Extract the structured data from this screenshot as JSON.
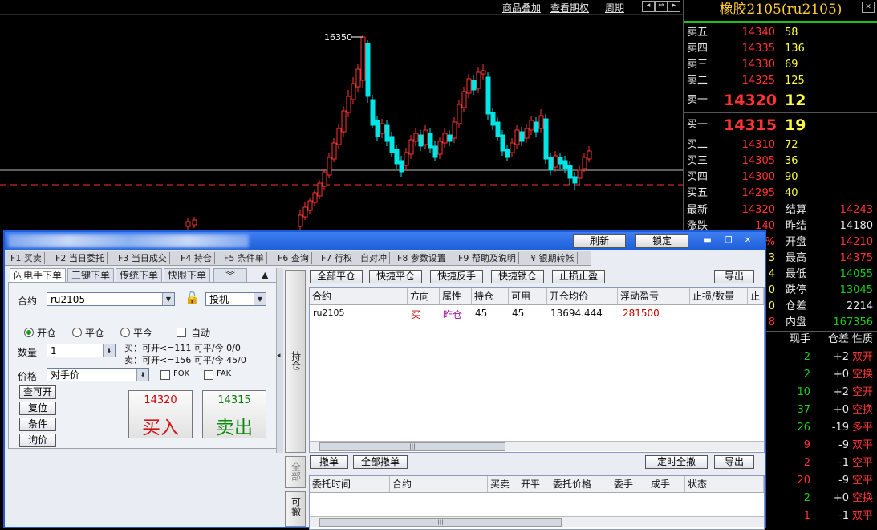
{
  "top_menu": {
    "items": [
      "商品叠加",
      "查看期权",
      "周期"
    ]
  },
  "chart": {
    "high_label": "16350",
    "colors": {
      "up": "#ff3232",
      "down": "#00e5e5",
      "ref_line": "#ff3030"
    }
  },
  "quote": {
    "title": "橡胶2105(ru2105)",
    "asks": [
      {
        "label": "卖五",
        "price": "14340",
        "vol": "58"
      },
      {
        "label": "卖四",
        "price": "14335",
        "vol": "136"
      },
      {
        "label": "卖三",
        "price": "14330",
        "vol": "69"
      },
      {
        "label": "卖二",
        "price": "14325",
        "vol": "125"
      },
      {
        "label": "卖一",
        "price": "14320",
        "vol": "12"
      }
    ],
    "bids": [
      {
        "label": "买一",
        "price": "14315",
        "vol": "19"
      },
      {
        "label": "买二",
        "price": "14310",
        "vol": "72"
      },
      {
        "label": "买三",
        "price": "14305",
        "vol": "36"
      },
      {
        "label": "买四",
        "price": "14300",
        "vol": "90"
      },
      {
        "label": "买五",
        "price": "14295",
        "vol": "40"
      }
    ],
    "stats": [
      {
        "l1": "最新",
        "v1": "14320",
        "l2": "结算",
        "v2": "14243"
      },
      {
        "l1": "涨跌",
        "v1": "140",
        "l2": "昨结",
        "v2": "14180"
      },
      {
        "l1": "",
        "v1": "%",
        "l2": "开盘",
        "v2": "14210"
      },
      {
        "l1": "",
        "v1": "3",
        "l2": "最高",
        "v2": "14375"
      },
      {
        "l1": "",
        "v1": "4",
        "l2": "最低",
        "v2": "14055"
      },
      {
        "l1": "",
        "v1": "0",
        "l2": "跌停",
        "v2": "13045"
      },
      {
        "l1": "",
        "v1": "0",
        "l2": "仓差",
        "v2": "2214"
      },
      {
        "l1": "",
        "v1": "8",
        "l2": "内盘",
        "v2": "167356"
      }
    ],
    "tick_header": {
      "h1": "现手",
      "h2": "仓差",
      "h3": "性质"
    },
    "ticks": [
      {
        "a": "2",
        "b": "+2",
        "c": "双开"
      },
      {
        "a": "2",
        "b": "+0",
        "c": "空换"
      },
      {
        "a": "10",
        "b": "+2",
        "c": "空开"
      },
      {
        "a": "37",
        "b": "+0",
        "c": "空换"
      },
      {
        "a": "26",
        "b": "-19",
        "c": "多平"
      },
      {
        "a": "9",
        "b": "-9",
        "c": "双平"
      },
      {
        "a": "2",
        "b": "-1",
        "c": "空平"
      },
      {
        "a": "20",
        "b": "-9",
        "c": "空平"
      },
      {
        "a": "2",
        "b": "+0",
        "c": "空换"
      },
      {
        "a": "1",
        "b": "-1",
        "c": "双平"
      }
    ]
  },
  "window": {
    "title_buttons": {
      "refresh": "刷新",
      "lock": "锁定"
    },
    "fkeys": [
      "F1 买卖",
      "F2 当日委托",
      "F3 当日成交",
      "F4 持仓",
      "F5 条件单",
      "F6 查询",
      "F7 行权",
      "自对冲",
      "F8 参数设置",
      "F9 帮助及说明",
      "¥ 银期转帐"
    ],
    "order": {
      "tabs": [
        "闪电手下单",
        "三键下单",
        "传统下单",
        "快限下单"
      ],
      "contract_label": "合约",
      "contract_value": "ru2105",
      "hedge_value": "投机",
      "radios": [
        "开仓",
        "平仓",
        "平今"
      ],
      "auto_label": "自动",
      "qty_label": "数量",
      "qty_value": "1",
      "buy_info": "买：可开<=111  可平/今 0/0",
      "sell_info": "卖：可开<=156  可平/今 45/0",
      "price_label": "价格",
      "price_value": "对手价",
      "fok": "FOK",
      "fak": "FAK",
      "side_buttons": [
        "查可开",
        "复位",
        "条件",
        "询价"
      ],
      "buy_price": "14320",
      "buy_label": "买入",
      "sell_price": "14315",
      "sell_label": "卖出"
    },
    "side_tabs": {
      "position": "持仓",
      "all": "全部",
      "cancelable": "可撤"
    },
    "positions": {
      "buttons": [
        "全部平仓",
        "快捷平仓",
        "快捷反手",
        "快捷锁仓",
        "止损止盈"
      ],
      "export": "导出",
      "columns": [
        "合约",
        "方向",
        "属性",
        "持仓",
        "可用",
        "开仓均价",
        "浮动盈亏",
        "止损/数量",
        "止"
      ],
      "rows": [
        {
          "contract": "ru2105",
          "dir": "买",
          "attr": "昨仓",
          "hold": "45",
          "avail": "45",
          "avg": "13694.444",
          "pnl": "281500"
        }
      ]
    },
    "orders": {
      "buttons": [
        "撤单",
        "全部撤单"
      ],
      "timed_cancel": "定时全撤",
      "export": "导出",
      "columns": [
        "委托时间",
        "合约",
        "买卖",
        "开平",
        "委托价格",
        "委手",
        "成手",
        "状态"
      ]
    }
  }
}
